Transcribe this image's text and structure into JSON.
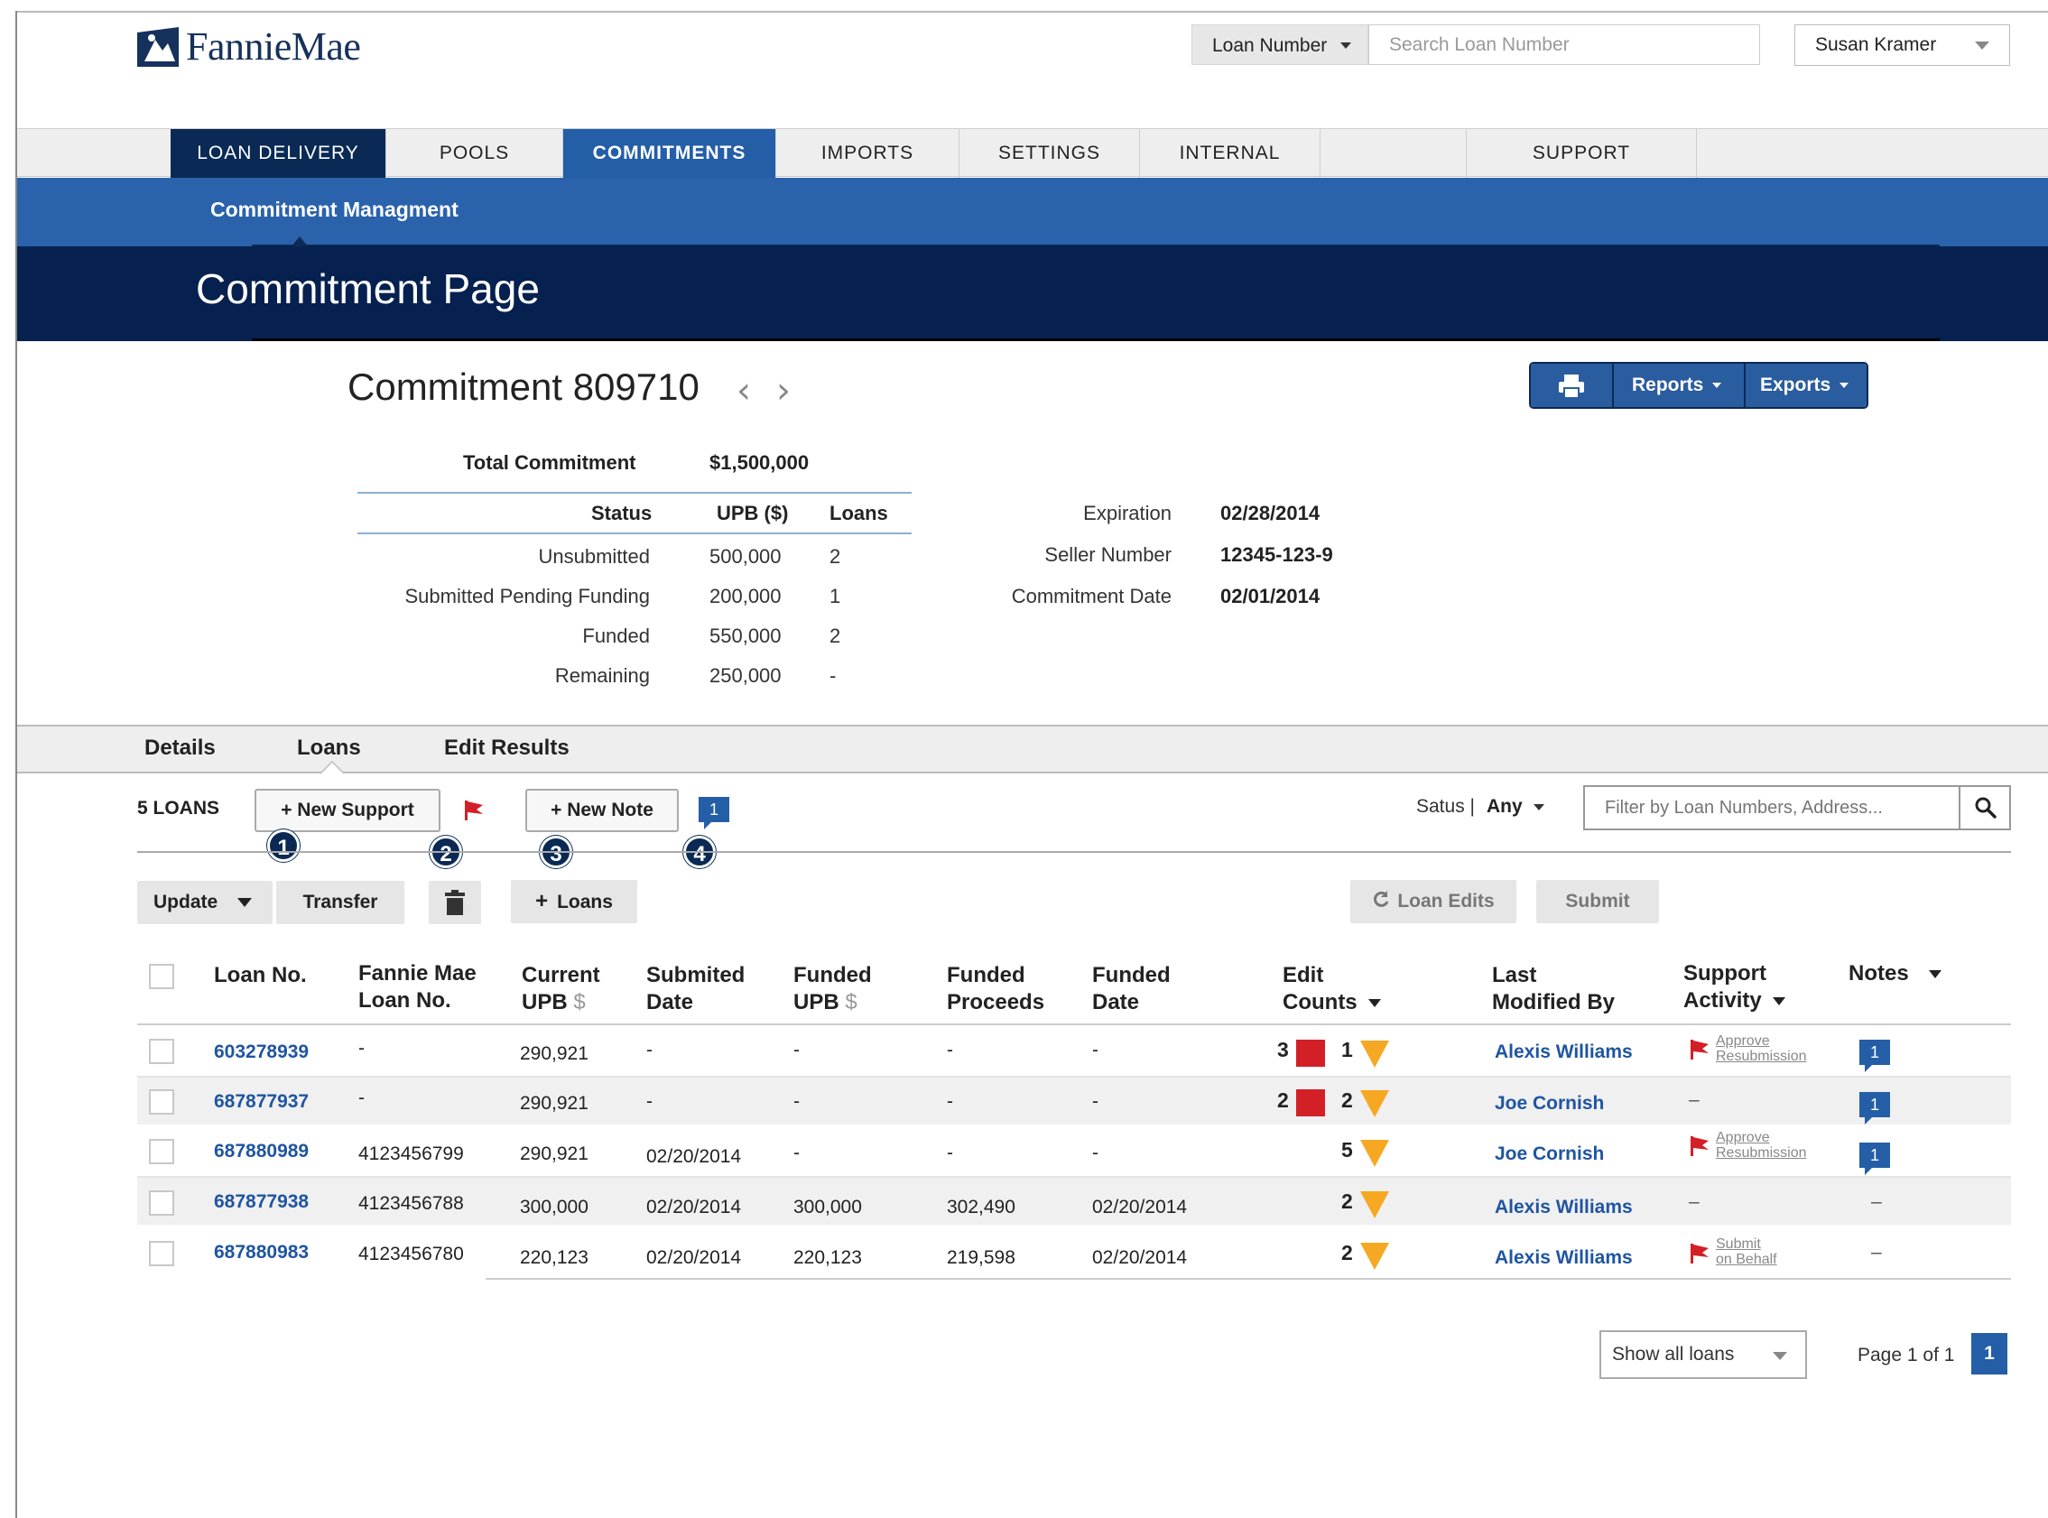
{
  "header": {
    "logo_text": "FannieMae",
    "search_type": "Loan Number",
    "search_placeholder": "Search Loan Number",
    "user_name": "Susan Kramer"
  },
  "nav": {
    "items": [
      "LOAN DELIVERY",
      "POOLS",
      "COMMITMENTS",
      "IMPORTS",
      "SETTINGS",
      "INTERNAL",
      "SUPPORT"
    ]
  },
  "subnav": {
    "label": "Commitment Managment"
  },
  "hero": {
    "title": "Commitment Page"
  },
  "commitment": {
    "title": "Commitment 809710",
    "prev_glyph": "‹",
    "next_glyph": "›",
    "reports_label": "Reports",
    "exports_label": "Exports"
  },
  "summary": {
    "total_label": "Total Commitment",
    "total_value": "$1,500,000",
    "col_status": "Status",
    "col_upb": "UPB ($)",
    "col_loans": "Loans",
    "rows": [
      {
        "status": "Unsubmitted",
        "upb": "500,000",
        "loans": "2"
      },
      {
        "status": "Submitted Pending Funding",
        "upb": "200,000",
        "loans": "1"
      },
      {
        "status": "Funded",
        "upb": "550,000",
        "loans": "2"
      },
      {
        "status": "Remaining",
        "upb": "250,000",
        "loans": "-"
      }
    ],
    "details": [
      {
        "label": "Expiration",
        "value": "02/28/2014"
      },
      {
        "label": "Seller Number",
        "value": "12345-123-9"
      },
      {
        "label": "Commitment Date",
        "value": "02/01/2014"
      }
    ]
  },
  "tabs": [
    "Details",
    "Loans",
    "Edit Results"
  ],
  "toolbar": {
    "count_label": "5 LOANS",
    "new_support": "+ New Support",
    "new_note": "+ New Note",
    "note_count": "1",
    "callouts": [
      "1",
      "2",
      "3",
      "4"
    ],
    "status_label": "Satus |",
    "status_value": "Any",
    "filter_placeholder": "Filter by Loan Numbers, Address...",
    "update_label": "Update",
    "transfer_label": "Transfer",
    "add_loans_label": "Loans",
    "loan_edits_label": "Loan Edits",
    "submit_label": "Submit"
  },
  "table": {
    "headers": {
      "loan_no": "Loan No.",
      "fm_loan_1": "Fannie Mae",
      "fm_loan_2": "Loan No.",
      "cur_upb_1": "Current",
      "cur_upb_2": "UPB",
      "sub_date_1": "Submited",
      "sub_date_2": "Date",
      "fund_upb_1": "Funded",
      "fund_upb_2": "UPB",
      "fund_proc_1": "Funded",
      "fund_proc_2": "Proceeds",
      "fund_date_1": "Funded",
      "fund_date_2": "Date",
      "edit_1": "Edit",
      "edit_2": "Counts",
      "mod_1": "Last",
      "mod_2": "Modified By",
      "sup_1": "Support",
      "sup_2": "Activity",
      "notes": "Notes",
      "dollar": "$"
    },
    "rows": [
      {
        "loan_no": "603278939",
        "fm_loan": "-",
        "cur_upb": "290,921",
        "sub_date": "-",
        "fund_upb": "-",
        "fund_proc": "-",
        "fund_date": "-",
        "red": "3",
        "yellow": "1",
        "modified": "Alexis Williams",
        "sup_1": "Approve",
        "sup_2": "Resubmission",
        "note": "1"
      },
      {
        "loan_no": "687877937",
        "fm_loan": "-",
        "cur_upb": "290,921",
        "sub_date": "-",
        "fund_upb": "-",
        "fund_proc": "-",
        "fund_date": "-",
        "red": "2",
        "yellow": "2",
        "modified": "Joe Cornish",
        "sup_dash": "–",
        "note": "1"
      },
      {
        "loan_no": "687880989",
        "fm_loan": "4123456799",
        "cur_upb": "290,921",
        "sub_date": "02/20/2014",
        "fund_upb": "-",
        "fund_proc": "-",
        "fund_date": "-",
        "yellow": "5",
        "modified": "Joe Cornish",
        "sup_1": "Approve",
        "sup_2": "Resubmission",
        "note": "1"
      },
      {
        "loan_no": "687877938",
        "fm_loan": "4123456788",
        "cur_upb": "300,000",
        "sub_date": "02/20/2014",
        "fund_upb": "300,000",
        "fund_proc": "302,490",
        "fund_date": "02/20/2014",
        "yellow": "2",
        "modified": "Alexis Williams",
        "sup_dash": "–",
        "note_dash": "–"
      },
      {
        "loan_no": "687880983",
        "fm_loan": "4123456780",
        "cur_upb": "220,123",
        "sub_date": "02/20/2014",
        "fund_upb": "220,123",
        "fund_proc": "219,598",
        "fund_date": "02/20/2014",
        "yellow": "2",
        "modified": "Alexis Williams",
        "sup_1": "Submit",
        "sup_2": "on Behalf",
        "note_dash": "–"
      }
    ]
  },
  "pagination": {
    "show_label": "Show all loans",
    "page_label": "Page 1 of 1",
    "current_page": "1"
  },
  "colors": {
    "nav_dark": "#0a2a55",
    "nav_active": "#245ea7",
    "link": "#1f55a1",
    "flag_red": "#d32027",
    "warning_yellow": "#f7a823"
  },
  "icons": [
    "search-icon",
    "print-icon",
    "trash-icon",
    "refresh-icon",
    "flag-icon",
    "note-icon",
    "warning-triangle-icon",
    "error-square-icon"
  ]
}
